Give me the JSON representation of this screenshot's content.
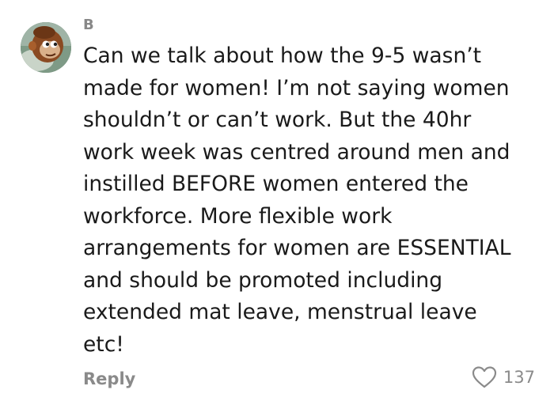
{
  "comment": {
    "author": "B",
    "text": "Can we talk about how the 9-5 wasn’t\nmade for women! I’m not saying women\nshouldn’t or can’t work. But the 40hr\nwork week was centred around men and\ninstilled BEFORE women entered the\nworkforce. More flexible work\narrangements for women are ESSENTIAL\nand should be promoted including\nextended mat leave, menstrual leave\netc!",
    "reply_label": "Reply",
    "like_count": "137",
    "avatar_icon": "monkey-puppet-avatar",
    "like_icon": "heart-outline-icon"
  },
  "colors": {
    "text": "#1a1a1a",
    "muted": "#8a8a8a",
    "background": "#ffffff"
  }
}
